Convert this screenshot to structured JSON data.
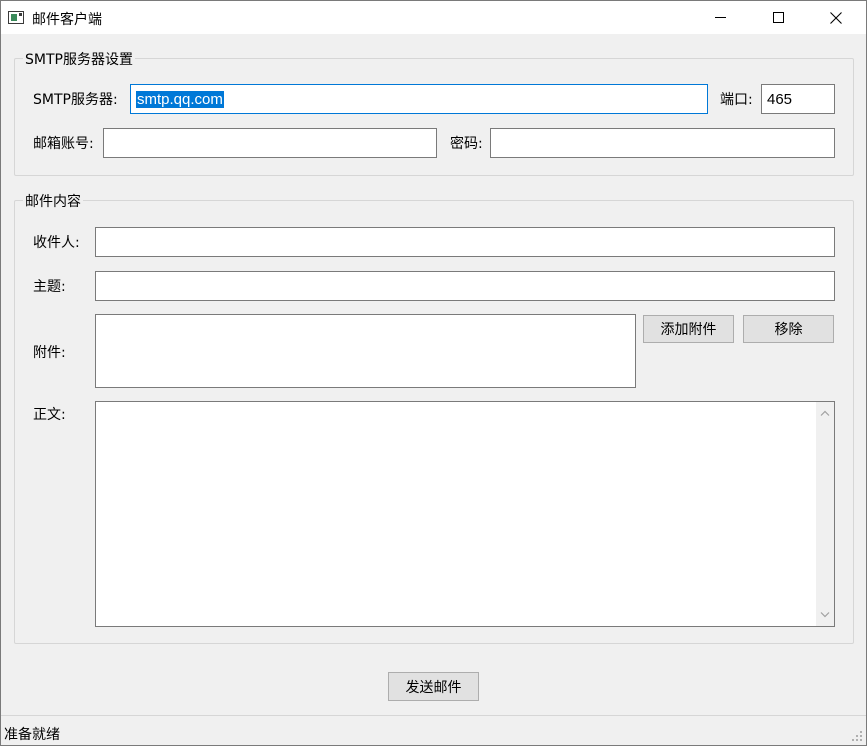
{
  "window": {
    "title": "邮件客户端"
  },
  "smtp_group": {
    "title": "SMTP服务器设置",
    "server_label": "SMTP服务器:",
    "server_value": "smtp.qq.com",
    "port_label": "端口:",
    "port_value": "465",
    "account_label": "邮箱账号:",
    "account_value": "",
    "password_label": "密码:",
    "password_value": ""
  },
  "content_group": {
    "title": "邮件内容",
    "recipient_label": "收件人:",
    "recipient_value": "",
    "subject_label": "主题:",
    "subject_value": "",
    "attachment_label": "附件:",
    "add_attachment_button": "添加附件",
    "remove_button": "移除",
    "body_label": "正文:",
    "body_value": ""
  },
  "send_button": "发送邮件",
  "status": "准备就绪"
}
